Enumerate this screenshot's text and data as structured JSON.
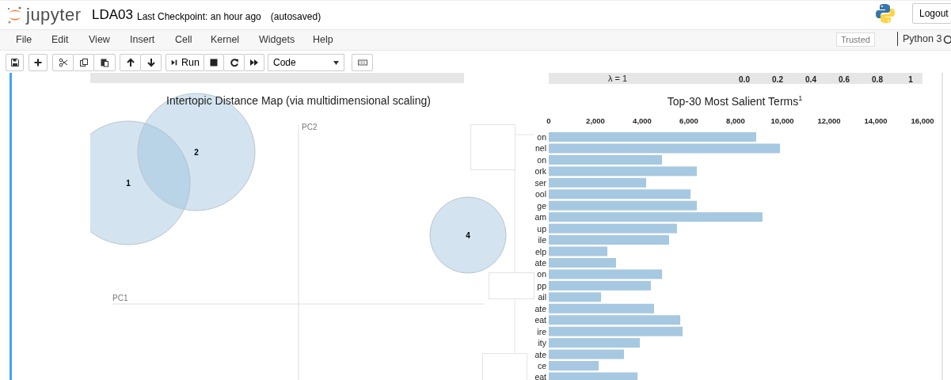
{
  "header": {
    "logo_text": "jupyter",
    "notebook_name": "LDA03",
    "checkpoint": "Last Checkpoint: an hour ago",
    "autosave": "(autosaved)",
    "logout": "Logout"
  },
  "menu": [
    "File",
    "Edit",
    "View",
    "Insert",
    "Cell",
    "Kernel",
    "Widgets",
    "Help"
  ],
  "trusted": "Trusted",
  "kernel_name": "Python 3",
  "toolbar": {
    "run": "Run",
    "cell_type": "Code"
  },
  "slider": {
    "label": "λ = 1",
    "ticks": [
      "0.0",
      "0.2",
      "0.4",
      "0.6",
      "0.8",
      "1"
    ]
  },
  "topic_map": {
    "title": "Intertopic Distance Map (via multidimensional scaling)",
    "axis_x": "PC1",
    "axis_y": "PC2",
    "topics": [
      {
        "label": "1"
      },
      {
        "label": "2"
      },
      {
        "label": "4"
      }
    ]
  },
  "terms_chart": {
    "title": "Top-30 Most Salient Terms$^{1}$",
    "chart_data": {
      "type": "bar",
      "orientation": "horizontal",
      "categories": [
        "on",
        "nel",
        "on",
        "ork",
        "ser",
        "ool",
        "ge",
        "am",
        "up",
        "ile",
        "elp",
        "ate",
        "on",
        "pp",
        "ail",
        "ate",
        "eat",
        "ire",
        "ity",
        "ate",
        "ce",
        "eat"
      ],
      "values": [
        8880,
        9900,
        4850,
        6340,
        4170,
        6070,
        6340,
        9150,
        5490,
        5150,
        2510,
        2880,
        4850,
        4370,
        2240,
        4510,
        5630,
        5730,
        3900,
        3220,
        2140,
        3800
      ],
      "xlim": [
        0,
        16000
      ],
      "xticks": [
        {
          "value": 0,
          "label": "0"
        },
        {
          "value": 2000,
          "label": "2,000"
        },
        {
          "value": 4000,
          "label": "4,000"
        },
        {
          "value": 6000,
          "label": "6,000"
        },
        {
          "value": 8000,
          "label": "8,000"
        },
        {
          "value": 10000,
          "label": "10,000"
        },
        {
          "value": 12000,
          "label": "12,000"
        },
        {
          "value": 14000,
          "label": "14,000"
        },
        {
          "value": 16000,
          "label": "16,000"
        }
      ]
    }
  }
}
